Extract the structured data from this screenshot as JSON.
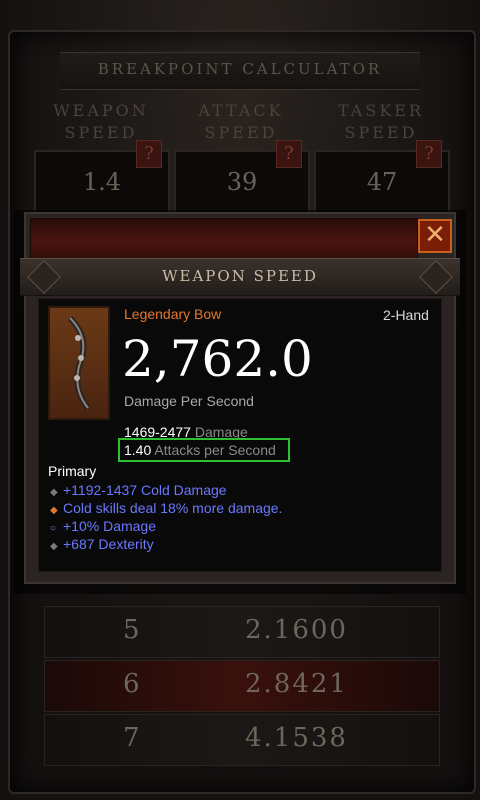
{
  "calculator": {
    "title": "BREAKPOINT CALCULATOR",
    "columns": [
      {
        "header_line1": "WEAPON",
        "header_line2": "SPEED",
        "value": "1.4",
        "help": "?"
      },
      {
        "header_line1": "ATTACK",
        "header_line2": "SPEED",
        "value": "39",
        "help": "?"
      },
      {
        "header_line1": "TASKER",
        "header_line2": "SPEED",
        "value": "47",
        "help": "?"
      }
    ],
    "rows": [
      {
        "num": "5",
        "value": "2.1600"
      },
      {
        "num": "6",
        "value": "2.8421"
      },
      {
        "num": "7",
        "value": "4.1538"
      }
    ]
  },
  "dialog": {
    "title": "WEAPON SPEED",
    "close_label": "✕",
    "item": {
      "rarity_type": "Legendary Bow",
      "handedness": "2-Hand",
      "dps": "2,762.0",
      "dps_label": "Damage Per Second",
      "damage_range": "1469-2477",
      "damage_label": "Damage",
      "aps_value": "1.40",
      "aps_label": "Attacks per Second",
      "primary_label": "Primary",
      "affixes": [
        {
          "text": "+1192-1437 Cold Damage",
          "bullet": "diamond-grey"
        },
        {
          "text": "Cold skills deal 18% more damage.",
          "bullet": "diamond-orange"
        },
        {
          "text": "+10% Damage",
          "bullet": "circle-blue"
        },
        {
          "text": "+687 Dexterity",
          "bullet": "diamond-grey"
        }
      ]
    }
  },
  "colors": {
    "legendary": "#e0782e",
    "affix_blue": "#6a78ff",
    "highlight_green": "#2fbf2f"
  }
}
